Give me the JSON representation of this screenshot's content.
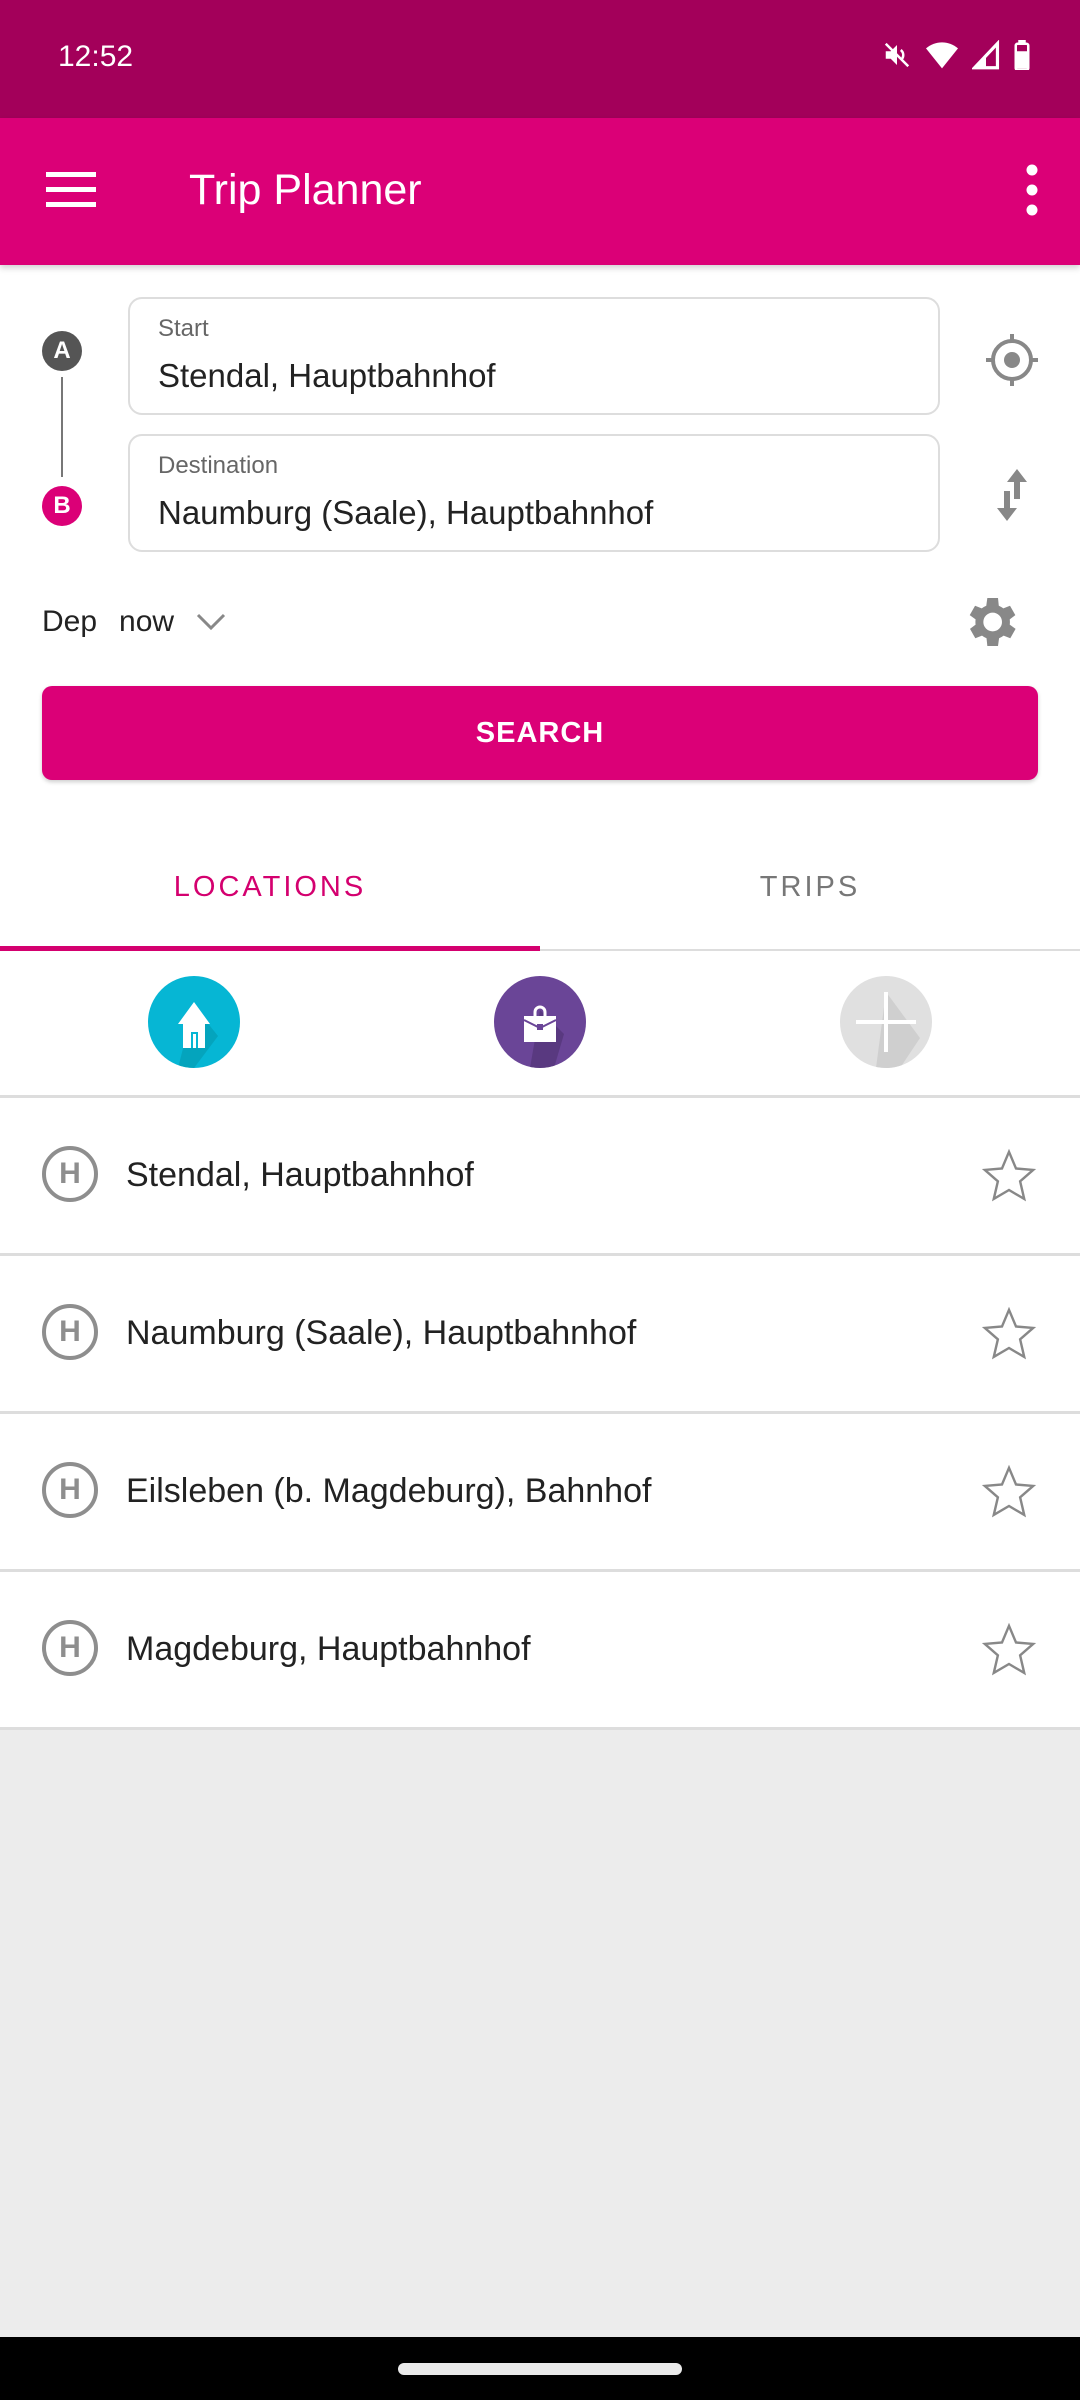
{
  "status_bar": {
    "time": "12:52",
    "icons": [
      "mute-icon",
      "wifi-icon",
      "signal-icon",
      "battery-icon"
    ]
  },
  "app_bar": {
    "title": "Trip Planner",
    "menu_icon": "hamburger-menu-icon",
    "overflow_icon": "more-vert-icon"
  },
  "form": {
    "start_badge": "A",
    "destination_badge": "B",
    "start": {
      "label": "Start",
      "value": "Stendal, Hauptbahnhof"
    },
    "destination": {
      "label": "Destination",
      "value": "Naumburg (Saale), Hauptbahnhof"
    },
    "locate_icon": "my-location-icon",
    "swap_icon": "swap-vert-icon",
    "departure": {
      "mode": "Dep",
      "time": "now"
    },
    "settings_icon": "gear-icon",
    "search_label": "SEARCH"
  },
  "tabs": [
    {
      "label": "LOCATIONS",
      "active": true
    },
    {
      "label": "TRIPS",
      "active": false
    }
  ],
  "favorites": [
    {
      "name": "home",
      "icon": "home-icon",
      "color": "#06b6d4"
    },
    {
      "name": "work",
      "icon": "briefcase-icon",
      "color": "#6a4597"
    },
    {
      "name": "add",
      "icon": "plus-icon",
      "color": "#dddddd"
    }
  ],
  "locations": [
    {
      "badge": "H",
      "name": "Stendal, Hauptbahnhof",
      "favorite": false
    },
    {
      "badge": "H",
      "name": "Naumburg (Saale), Hauptbahnhof",
      "favorite": false
    },
    {
      "badge": "H",
      "name": "Eilsleben (b. Magdeburg), Bahnhof",
      "favorite": false
    },
    {
      "badge": "H",
      "name": "Magdeburg, Hauptbahnhof",
      "favorite": false
    }
  ],
  "colors": {
    "primary": "#db0077",
    "primary_dark": "#a3005a",
    "accent": "#d4006f",
    "badge_a": "#555555"
  }
}
